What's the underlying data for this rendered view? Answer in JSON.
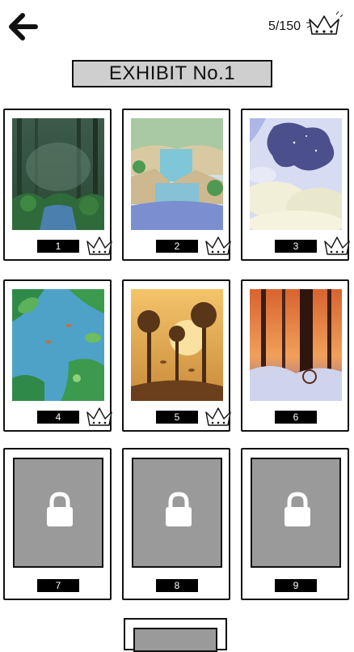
{
  "header": {
    "progress": "5/150",
    "back_icon": "arrow-left-icon",
    "crown_icon": "crown-icon"
  },
  "title": "EXHIBIT No.1",
  "cards": [
    {
      "number": "1",
      "unlocked": true,
      "crowned": true,
      "scene": "misty jungle with stream"
    },
    {
      "number": "2",
      "unlocked": true,
      "crowned": true,
      "scene": "waterfall over rocks"
    },
    {
      "number": "3",
      "unlocked": true,
      "crowned": true,
      "scene": "starry sky above clouds"
    },
    {
      "number": "4",
      "unlocked": true,
      "crowned": true,
      "scene": "river with leaves and lily pads"
    },
    {
      "number": "5",
      "unlocked": true,
      "crowned": true,
      "scene": "golden forest silhouettes"
    },
    {
      "number": "6",
      "unlocked": true,
      "crowned": false,
      "scene": "sunset woods with snow"
    },
    {
      "number": "7",
      "unlocked": false,
      "crowned": false
    },
    {
      "number": "8",
      "unlocked": false,
      "crowned": false
    },
    {
      "number": "9",
      "unlocked": false,
      "crowned": false
    }
  ],
  "colors": {
    "locked_fill": "#9a9a9a",
    "title_fill": "#cfcfcf",
    "number_tag": "#000000"
  }
}
